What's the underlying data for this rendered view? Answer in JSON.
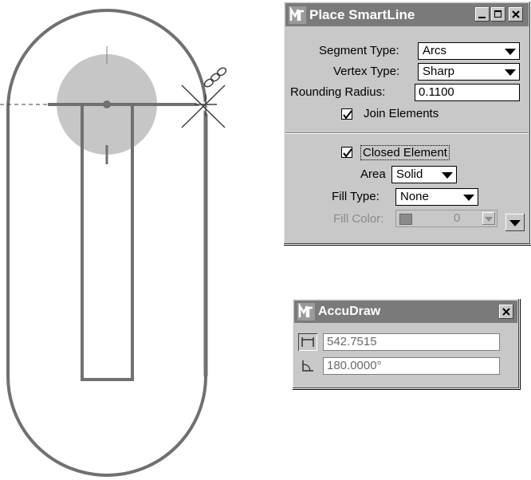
{
  "smartline": {
    "title": "Place SmartLine",
    "segment_type_label": "Segment Type:",
    "segment_type_value": "Arcs",
    "vertex_type_label": "Vertex Type:",
    "vertex_type_value": "Sharp",
    "rounding_radius_label": "Rounding Radius:",
    "rounding_radius_value": "0.1100",
    "join_elements_label": "Join Elements",
    "join_elements_checked": true,
    "closed_element_label": "Closed Element",
    "closed_element_checked": true,
    "area_label": "Area",
    "area_value": "Solid",
    "fill_type_label": "Fill Type:",
    "fill_type_value": "None",
    "fill_color_label": "Fill Color:",
    "fill_color_value": "0"
  },
  "accudraw": {
    "title": "AccuDraw",
    "distance_value": "542.7515",
    "angle_value": "180.0000°"
  },
  "colors": {
    "titlebar": "#7a7a7a",
    "panel": "#c8c8c8",
    "drawing_line": "#707070",
    "compass_fill": "#c8c8c8"
  }
}
